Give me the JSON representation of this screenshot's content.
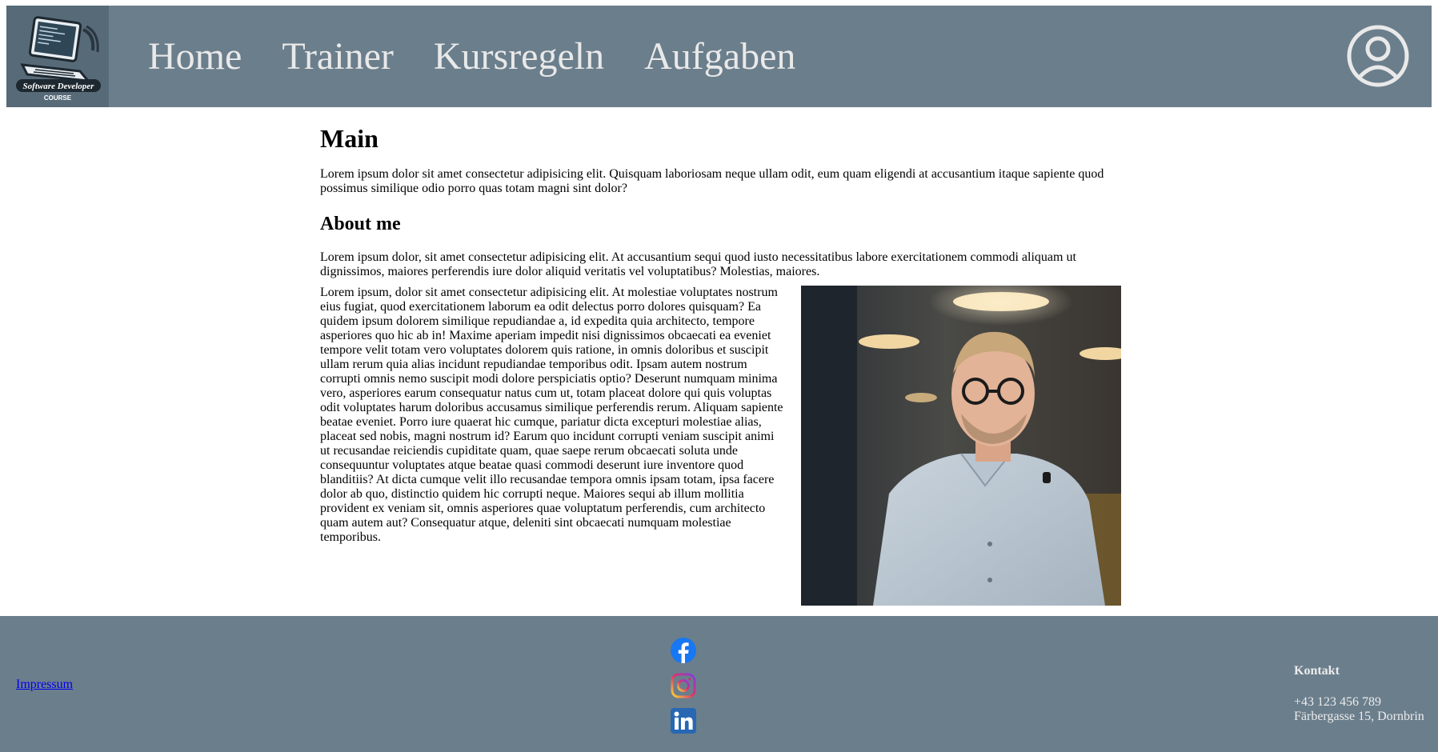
{
  "header": {
    "logo_text": "Software Developer",
    "logo_subtext": "COURSE",
    "nav": [
      {
        "label": "Home"
      },
      {
        "label": "Trainer"
      },
      {
        "label": "Kursregeln"
      },
      {
        "label": "Aufgaben"
      }
    ],
    "profile_icon": "user-circle-icon"
  },
  "main": {
    "title": "Main",
    "intro": "Lorem ipsum dolor sit amet consectetur adipisicing elit. Quisquam laboriosam neque ullam odit, eum quam eligendi at accusantium itaque sapiente quod possimus similique odio porro quas totam magni sint dolor?",
    "about_title": "About me",
    "about_intro": "Lorem ipsum dolor, sit amet consectetur adipisicing elit. At accusantium sequi quod iusto necessitatibus labore exercitationem commodi aliquam ut dignissimos, maiores perferendis iure dolor aliquid veritatis vel voluptatibus? Molestias, maiores.",
    "about_text": "Lorem ipsum, dolor sit amet consectetur adipisicing elit. At molestiae voluptates nostrum eius fugiat, quod exercitationem laborum ea odit delectus porro dolores quisquam? Ea quidem ipsum dolorem similique repudiandae a, id expedita quia architecto, tempore asperiores quo hic ab in! Maxime aperiam impedit nisi dignissimos obcaecati ea eveniet tempore velit totam vero voluptates dolorem quis ratione, in omnis doloribus et suscipit ullam rerum quia alias incidunt repudiandae temporibus odit. Ipsam autem nostrum corrupti omnis nemo suscipit modi dolore perspiciatis optio? Deserunt numquam minima vero, asperiores earum consequatur natus cum ut, totam placeat dolore qui quis voluptas odit voluptates harum doloribus accusamus similique perferendis rerum. Aliquam sapiente beatae eveniet. Porro iure quaerat hic cumque, pariatur dicta excepturi molestiae alias, placeat sed nobis, magni nostrum id? Earum quo incidunt corrupti veniam suscipit animi ut recusandae reiciendis cupiditate quam, quae saepe rerum obcaecati soluta unde consequuntur voluptates atque beatae quasi commodi deserunt iure inventore quod blanditiis? At dicta cumque velit illo recusandae tempora omnis ipsam totam, ipsa facere dolor ab quo, distinctio quidem hic corrupti neque. Maiores sequi ab illum mollitia provident ex veniam sit, omnis asperiores quae voluptatum perferendis, cum architecto quam autem aut? Consequatur atque, deleniti sint obcaecati numquam molestiae temporibus."
  },
  "footer": {
    "impressum": "Impressum",
    "social": [
      "facebook-icon",
      "instagram-icon",
      "linkedin-icon"
    ],
    "kontakt_title": "Kontakt",
    "phone": "+43 123 456 789",
    "address": "Färbergasse 15, Dornbrin"
  },
  "colors": {
    "header_bg": "#6b7e8c",
    "nav_text": "#e9e9e9",
    "footer_bg": "#6b7e8c"
  }
}
